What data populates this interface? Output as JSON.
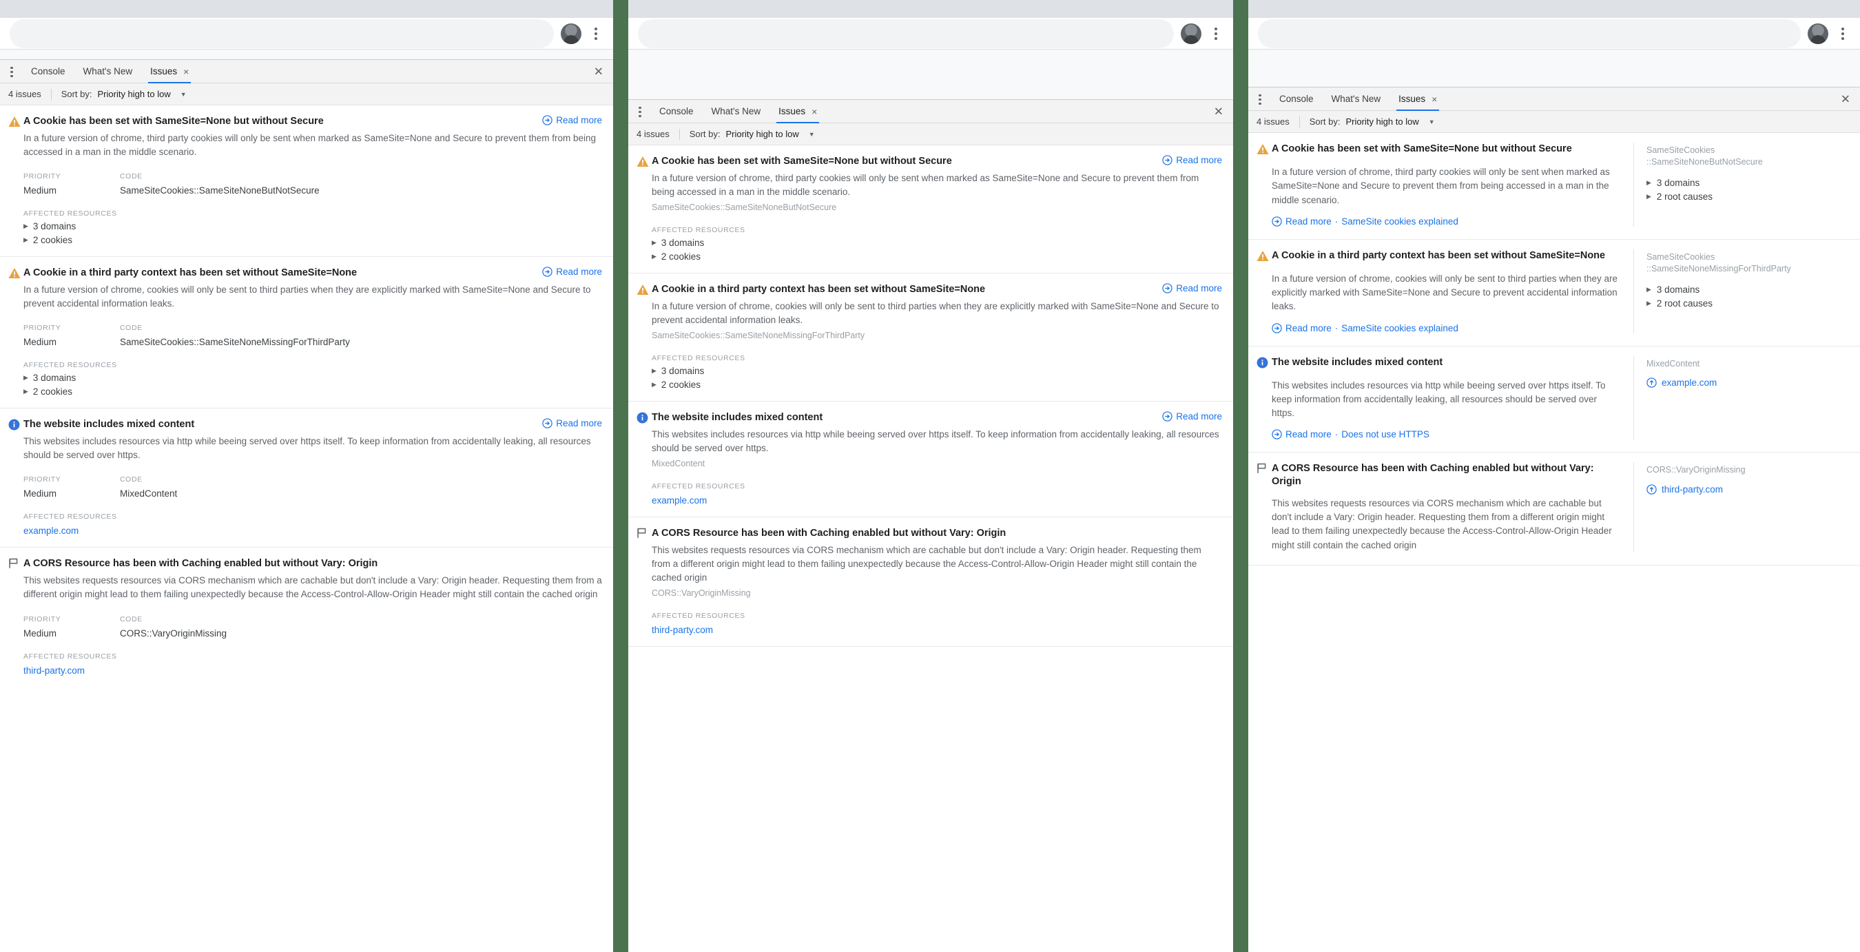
{
  "browser": {
    "avatar_name": "profile-avatar",
    "menu_icon": "kebab-menu-icon",
    "omnibox_placeholder": ""
  },
  "devtools": {
    "tabs": [
      {
        "label": "Console",
        "active": false,
        "closable": false
      },
      {
        "label": "What's New",
        "active": false,
        "closable": false
      },
      {
        "label": "Issues",
        "active": true,
        "closable": true
      }
    ],
    "tab_close_glyph": "×",
    "drawer_close_glyph": "✕",
    "more_icon": "kebab-menu-icon",
    "toolbar": {
      "issue_count": "4 issues",
      "sort_label": "Sort by:",
      "sort_value": "Priority high to low",
      "caret_glyph": "▼"
    },
    "labels": {
      "priority": "PRIORITY",
      "code": "CODE",
      "affected_resources": "AFFECTED RESOURCES",
      "read_more": "Read more",
      "separator_dot": "·"
    }
  },
  "colors": {
    "accent_blue": "#1a73e8",
    "warning_orange": "#e8a33d",
    "info_blue": "#1a73e8",
    "flag_gray": "#5f6368",
    "divider_green": "#4b7350",
    "tabstrip_gray": "#dee1e6"
  },
  "issues": [
    {
      "severity": "warning",
      "severity_icon": "warning-triangle-icon",
      "title": "A Cookie has been set with SameSite=None but without Secure",
      "description": "In a future version of chrome, third party cookies will only be sent when marked as SameSite=None and Secure to prevent them from being accessed in a man in the middle scenario.",
      "priority": "Medium",
      "code": "SameSiteCookies::SameSiteNoneButNotSecure",
      "code_line1": "SameSiteCookies",
      "code_line2": "::SameSiteNoneButNotSecure",
      "resources_v1": [
        "3 domains",
        "2 cookies"
      ],
      "resources_v3": [
        "3 domains",
        "2 root causes"
      ],
      "resource_link": null,
      "extra_link": "SameSite cookies explained"
    },
    {
      "severity": "warning",
      "severity_icon": "warning-triangle-icon",
      "title": "A Cookie in a third party context has been set without SameSite=None",
      "description": "In a future version of chrome, cookies will only be sent to third parties when they are explicitly marked with SameSite=None and Secure to prevent accidental information leaks.",
      "priority": "Medium",
      "code": "SameSiteCookies::SameSiteNoneMissingForThirdParty",
      "code_line1": "SameSiteCookies",
      "code_line2": "::SameSiteNoneMissingForThirdParty",
      "resources_v1": [
        "3 domains",
        "2 cookies"
      ],
      "resources_v3": [
        "3 domains",
        "2 root causes"
      ],
      "resource_link": null,
      "extra_link": "SameSite cookies explained"
    },
    {
      "severity": "info",
      "severity_icon": "info-circle-icon",
      "title": "The website includes mixed content",
      "description": "This websites includes resources via http while beeing served over https itself. To keep information from accidentally leaking, all resources should be served over https.",
      "priority": "Medium",
      "code": "MixedContent",
      "code_line1": "MixedContent",
      "code_line2": "",
      "resources_v1": [],
      "resources_v3": [],
      "resource_link": "example.com",
      "extra_link": "Does not use HTTPS"
    },
    {
      "severity": "flag",
      "severity_icon": "flag-icon",
      "title": "A CORS Resource has been with Caching enabled but without Vary: Origin",
      "description": "This websites requests resources via CORS mechanism which are cachable but don't include a Vary: Origin header. Requesting them from a different origin might lead to them failing unexpectedly because the Access-Control-Allow-Origin Header might still contain the cached origin",
      "priority": "Medium",
      "code": "CORS::VaryOriginMissing",
      "code_line1": "CORS::VaryOriginMissing",
      "code_line2": "",
      "resources_v1": [],
      "resources_v3": [],
      "resource_link": "third-party.com",
      "extra_link": null
    }
  ]
}
